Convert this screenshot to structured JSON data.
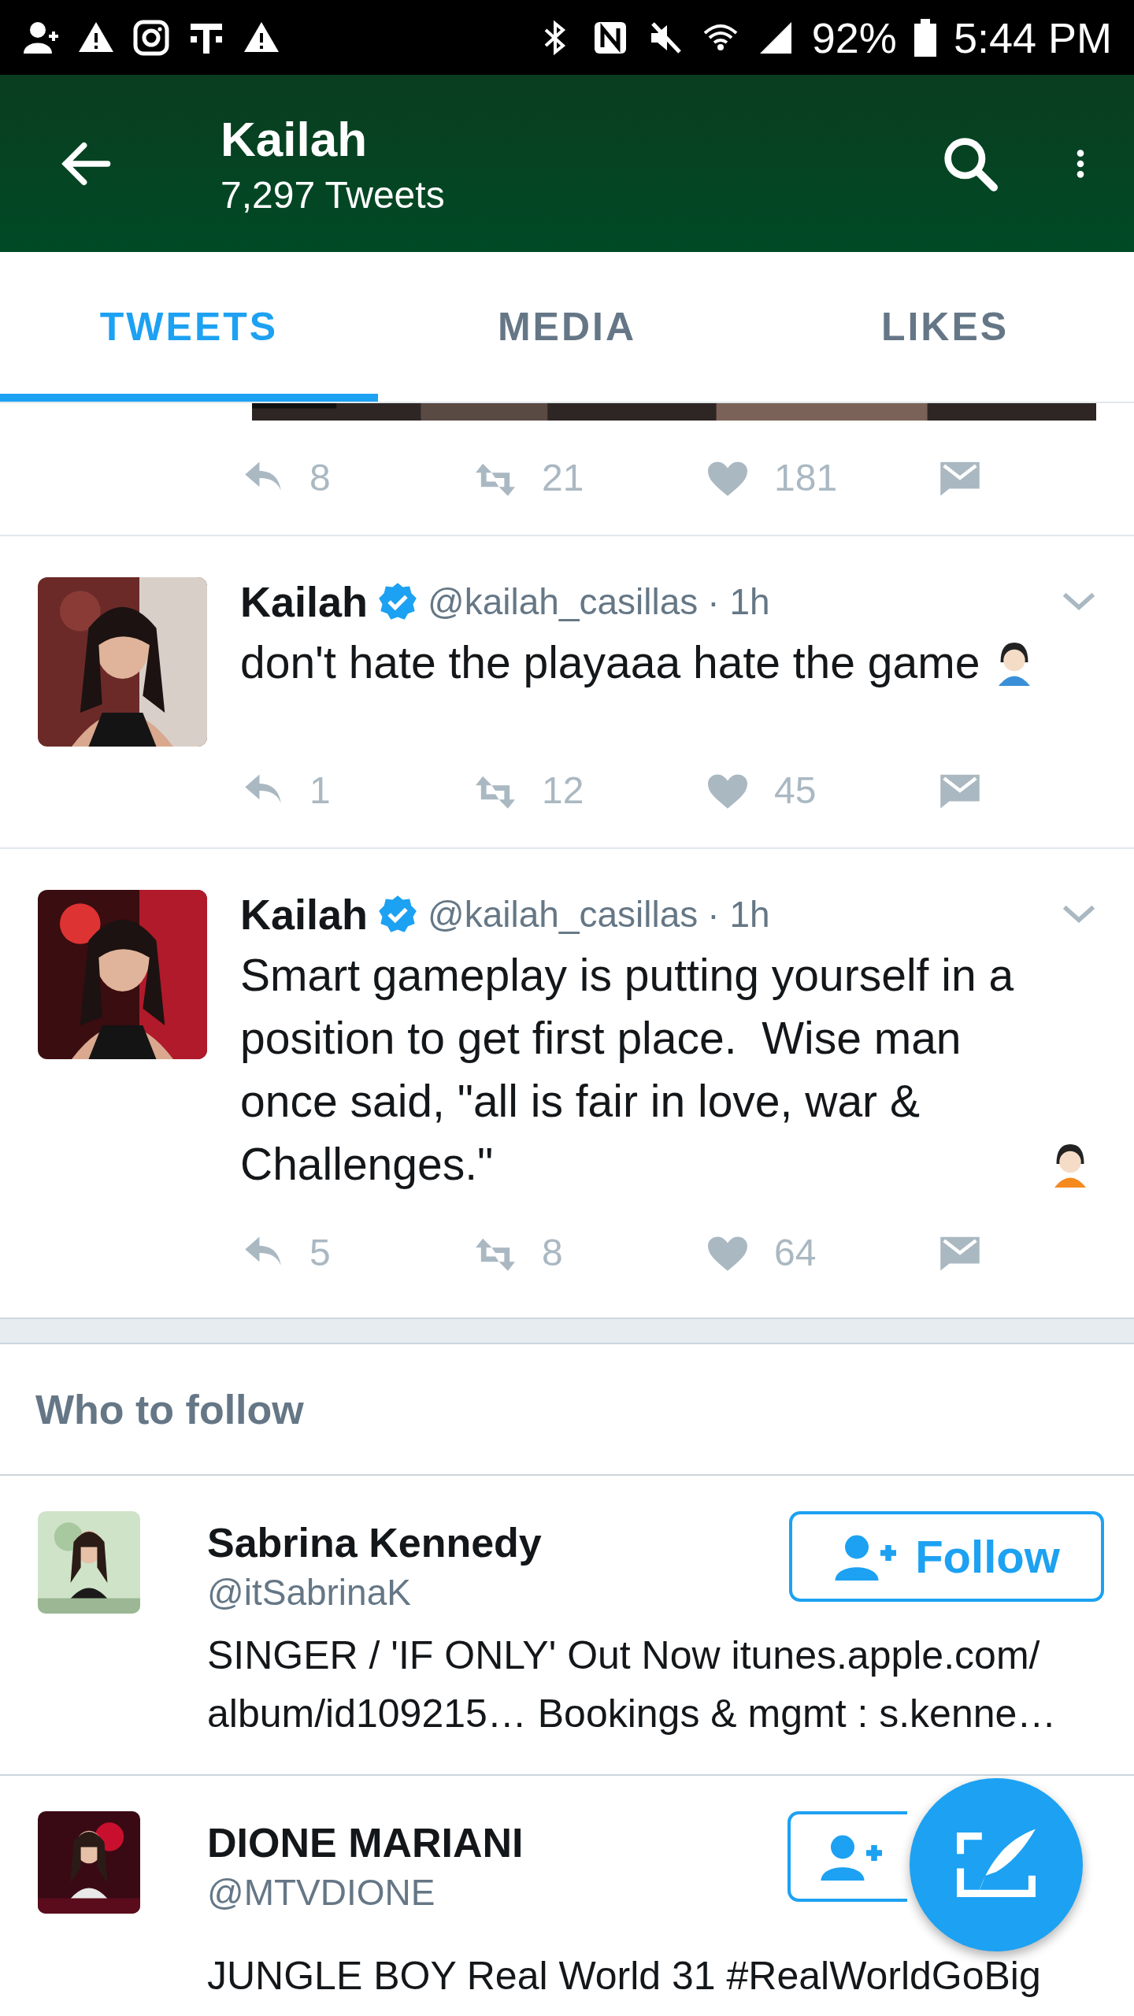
{
  "status_bar": {
    "battery": "92%",
    "time": "5:44 PM"
  },
  "header": {
    "title": "Kailah",
    "subtitle": "7,297 Tweets"
  },
  "tabs": [
    {
      "label": "TWEETS",
      "selected": true
    },
    {
      "label": "MEDIA",
      "selected": false
    },
    {
      "label": "LIKES",
      "selected": false
    }
  ],
  "partial_tweet": {
    "replies": "8",
    "retweets": "21",
    "likes": "181"
  },
  "tweets": [
    {
      "name": "Kailah",
      "handle": "@kailah_casillas",
      "time": "· 1h",
      "text": "don't hate the playaaa hate the game",
      "replies": "1",
      "retweets": "12",
      "likes": "45"
    },
    {
      "name": "Kailah",
      "handle": "@kailah_casillas",
      "time": "· 1h",
      "text": "Smart gameplay is putting yourself in a position to get first place.  Wise man once said, \"all is fair in love, war & Challenges.\"",
      "replies": "5",
      "retweets": "8",
      "likes": "64"
    }
  ],
  "who_to_follow": {
    "title": "Who to follow",
    "accounts": [
      {
        "name": "Sabrina Kennedy",
        "handle": "@itSabrinaK",
        "bio": "SINGER / 'IF ONLY' Out Now itunes.apple.com/ album/id109215… Bookings & mgmt : s.kenne…",
        "follow_label": "Follow"
      },
      {
        "name": "DIONE MARIANI",
        "handle": "@MTVDIONE",
        "bio": "JUNGLE BOY Real World 31 #RealWorldGoBig"
      }
    ]
  }
}
